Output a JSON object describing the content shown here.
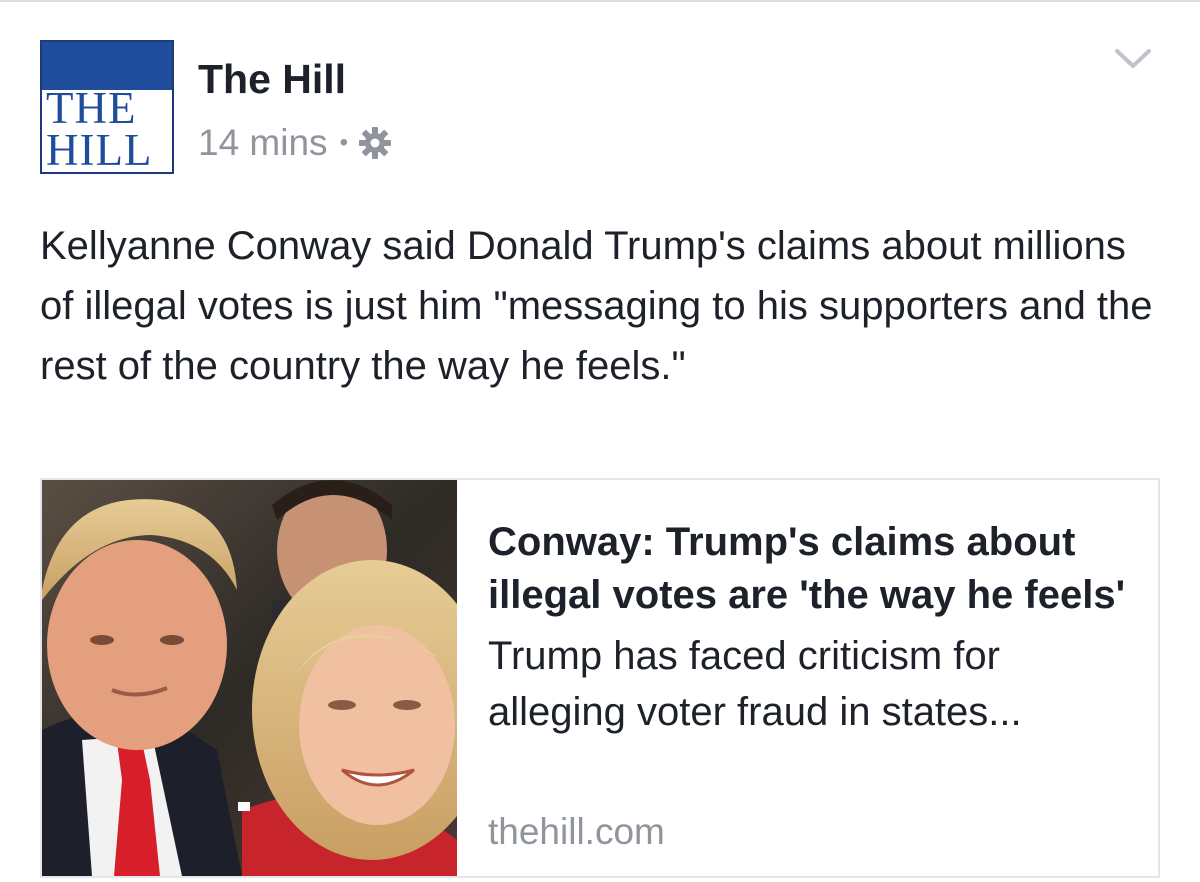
{
  "post": {
    "logo": {
      "line1": "THE",
      "line2": "HILL",
      "brand_color": "#1f4d9c"
    },
    "page_name": "The Hill",
    "timestamp": "14 mins",
    "separator": "•",
    "audience_icon": "gear-icon",
    "menu_icon": "chevron-down-icon",
    "text": "Kellyanne Conway said Donald Trump's claims about millions of illegal votes is just him \"messaging to his supporters and the rest of the country the way he feels.\"",
    "link_card": {
      "title": "Conway: Trump's claims about illegal votes are 'the way he feels'",
      "description": "Trump has faced criticism for alleging voter fraud in states...",
      "domain": "thehill.com"
    }
  },
  "colors": {
    "text_primary": "#1d2129",
    "text_secondary": "#90949c",
    "border": "#e4e6eb"
  }
}
